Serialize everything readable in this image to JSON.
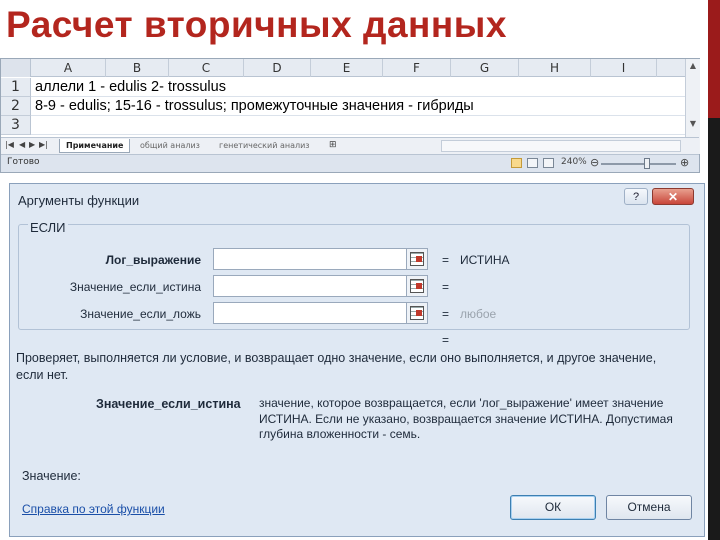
{
  "slide": {
    "title": "Расчет вторичных данных"
  },
  "sheet": {
    "columns": [
      "A",
      "B",
      "C",
      "D",
      "E",
      "F",
      "G",
      "H",
      "I"
    ],
    "rows": [
      {
        "num": "1",
        "text": "аллели 1 - edulis 2- trossulus"
      },
      {
        "num": "2",
        "text": "8-9 - edulis; 15-16 - trossulus; промежуточные значения - гибриды"
      },
      {
        "num": "3",
        "text": ""
      }
    ],
    "tabs": [
      "Примечание",
      "общий анализ",
      "генетический анализ"
    ],
    "status": "Готово",
    "zoom": "240%"
  },
  "dialog": {
    "title": "Аргументы функции",
    "help": "?",
    "close": "✕",
    "function_name": "ЕСЛИ",
    "args": [
      {
        "label": "Лог_выражение",
        "value": "",
        "eq": "=",
        "result": "ИСТИНА"
      },
      {
        "label": "Значение_если_истина",
        "value": "",
        "eq": "=",
        "result": ""
      },
      {
        "label": "Значение_если_ложь",
        "value": "",
        "eq": "=",
        "result": "любое"
      }
    ],
    "main_eq": "=",
    "description": "Проверяет, выполняется ли условие, и возвращает одно значение, если оно выполняется, и другое значение, если нет.",
    "arg_desc_name": "Значение_если_истина",
    "arg_desc_text": "значение, которое возвращается, если 'лог_выражение' имеет значение ИСТИНА. Если не указано, возвращается значение ИСТИНА. Допустимая глубина вложенности - семь.",
    "value_label": "Значение:",
    "help_link": "Справка по этой функции",
    "ok": "ОК",
    "cancel": "Отмена"
  },
  "colors": {
    "title": "#b3261e",
    "accent_bar": "#9b1b1b",
    "dialog_bg": "#dfe8f3",
    "link": "#1a4fa8"
  }
}
